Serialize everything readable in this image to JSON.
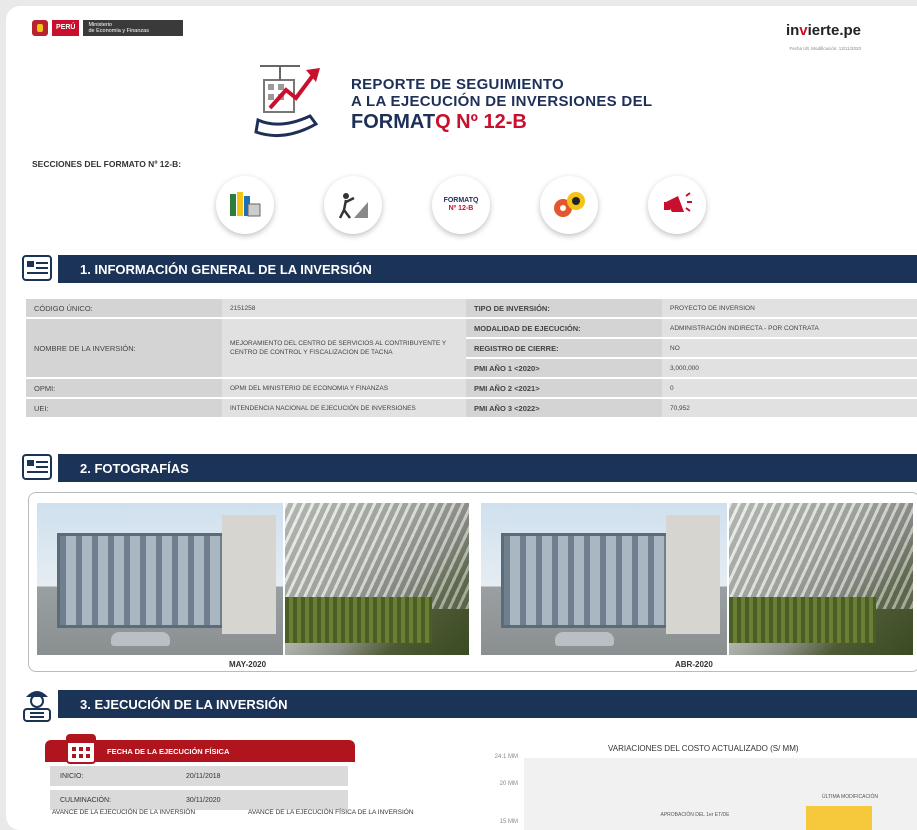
{
  "header": {
    "peru_label": "PERÚ",
    "ministry_line1": "Ministerio",
    "ministry_line2": "de Economía y Finanzas",
    "brand_prefix": "in",
    "brand_hat": "v",
    "brand_suffix": "ierte.pe",
    "last_modified": "Fecha Ult. Modificación: 13/11/2020",
    "title_line1": "REPORTE DE SEGUIMIENTO",
    "title_line2": "A LA EJECUCIÓN DE INVERSIONES DEL",
    "title_line3a": "FORMAT",
    "title_line3b": "Q Nº 12-B",
    "sections_label": "SECCIONES DEL FORMATO Nº 12-B:",
    "sec_icon_fmt_top": "FORMATQ",
    "sec_icon_fmt_bottom": "Nº 12-B",
    "sec_icon_colors": [
      "#2e7d3a",
      "#1e2f58",
      "#c8102e",
      "#e4572e",
      "#c8102e"
    ]
  },
  "section1": {
    "title": "1. INFORMACIÓN GENERAL DE LA INVERSIÓN",
    "rows": {
      "codigo_k": "CÓDIGO ÚNICO:",
      "codigo_v": "2151258",
      "tipo_k": "TIPO DE INVERSIÓN:",
      "tipo_v": "PROYECTO DE INVERSION",
      "nombre_k": "NOMBRE DE LA INVERSIÓN:",
      "nombre_v": "MEJORAMIENTO DEL CENTRO DE SERVICIOS AL CONTRIBUYENTE Y CENTRO DE CONTROL Y FISCALIZACION DE TACNA",
      "modalidad_k": "MODALIDAD DE EJECUCIÓN:",
      "modalidad_v": "ADMINISTRACIÓN INDIRECTA - POR CONTRATA",
      "registro_k": "REGISTRO DE CIERRE:",
      "registro_v": "NO",
      "pmi1_k": "PMI AÑO 1 <2020>",
      "pmi1_v": "3,000,000",
      "opmi_k": "OPMI:",
      "opmi_v": "OPMI DEL MINISTERIO DE ECONOMIA Y FINANZAS",
      "pmi2_k": "PMI AÑO 2 <2021>",
      "pmi2_v": "0",
      "uei_k": "UEI:",
      "uei_v": "INTENDENCIA NACIONAL DE EJECUCIÓN DE INVERSIONES",
      "pmi3_k": "PMI AÑO 3 <2022>",
      "pmi3_v": "70,952"
    }
  },
  "section2": {
    "title": "2. FOTOGRAFÍAS",
    "caption_left": "MAY-2020",
    "caption_right": "ABR-2020"
  },
  "section3": {
    "title": "3. EJECUCIÓN DE LA INVERSIÓN",
    "fecha_title": "FECHA DE LA EJECUCIÓN FÍSICA",
    "inicio_k": "INICIO:",
    "inicio_v": "20/11/2018",
    "culminacion_k": "CULMINACIÓN:",
    "culminacion_v": "30/11/2020",
    "avance_inv": "AVANCE DE LA EJECUCIÓN DE LA INVERSIÓN",
    "avance_fis": "AVANCE DE LA EJECUCIÓN FÍSICA DE LA INVERSIÓN"
  },
  "chart_data": {
    "type": "bar",
    "title": "VARIACIONES DEL COSTO ACTUALIZADO (S/ MM)",
    "ytick_labels": [
      "24.1 MM",
      "20 MM",
      "15 MM"
    ],
    "y_ticks": [
      24.1,
      20,
      15
    ],
    "categories": [
      "APROBACIÓN DEL 1er ET/DE",
      "ÚLTIMA MODIFICACIÓN"
    ],
    "color": "#f6c93d"
  }
}
